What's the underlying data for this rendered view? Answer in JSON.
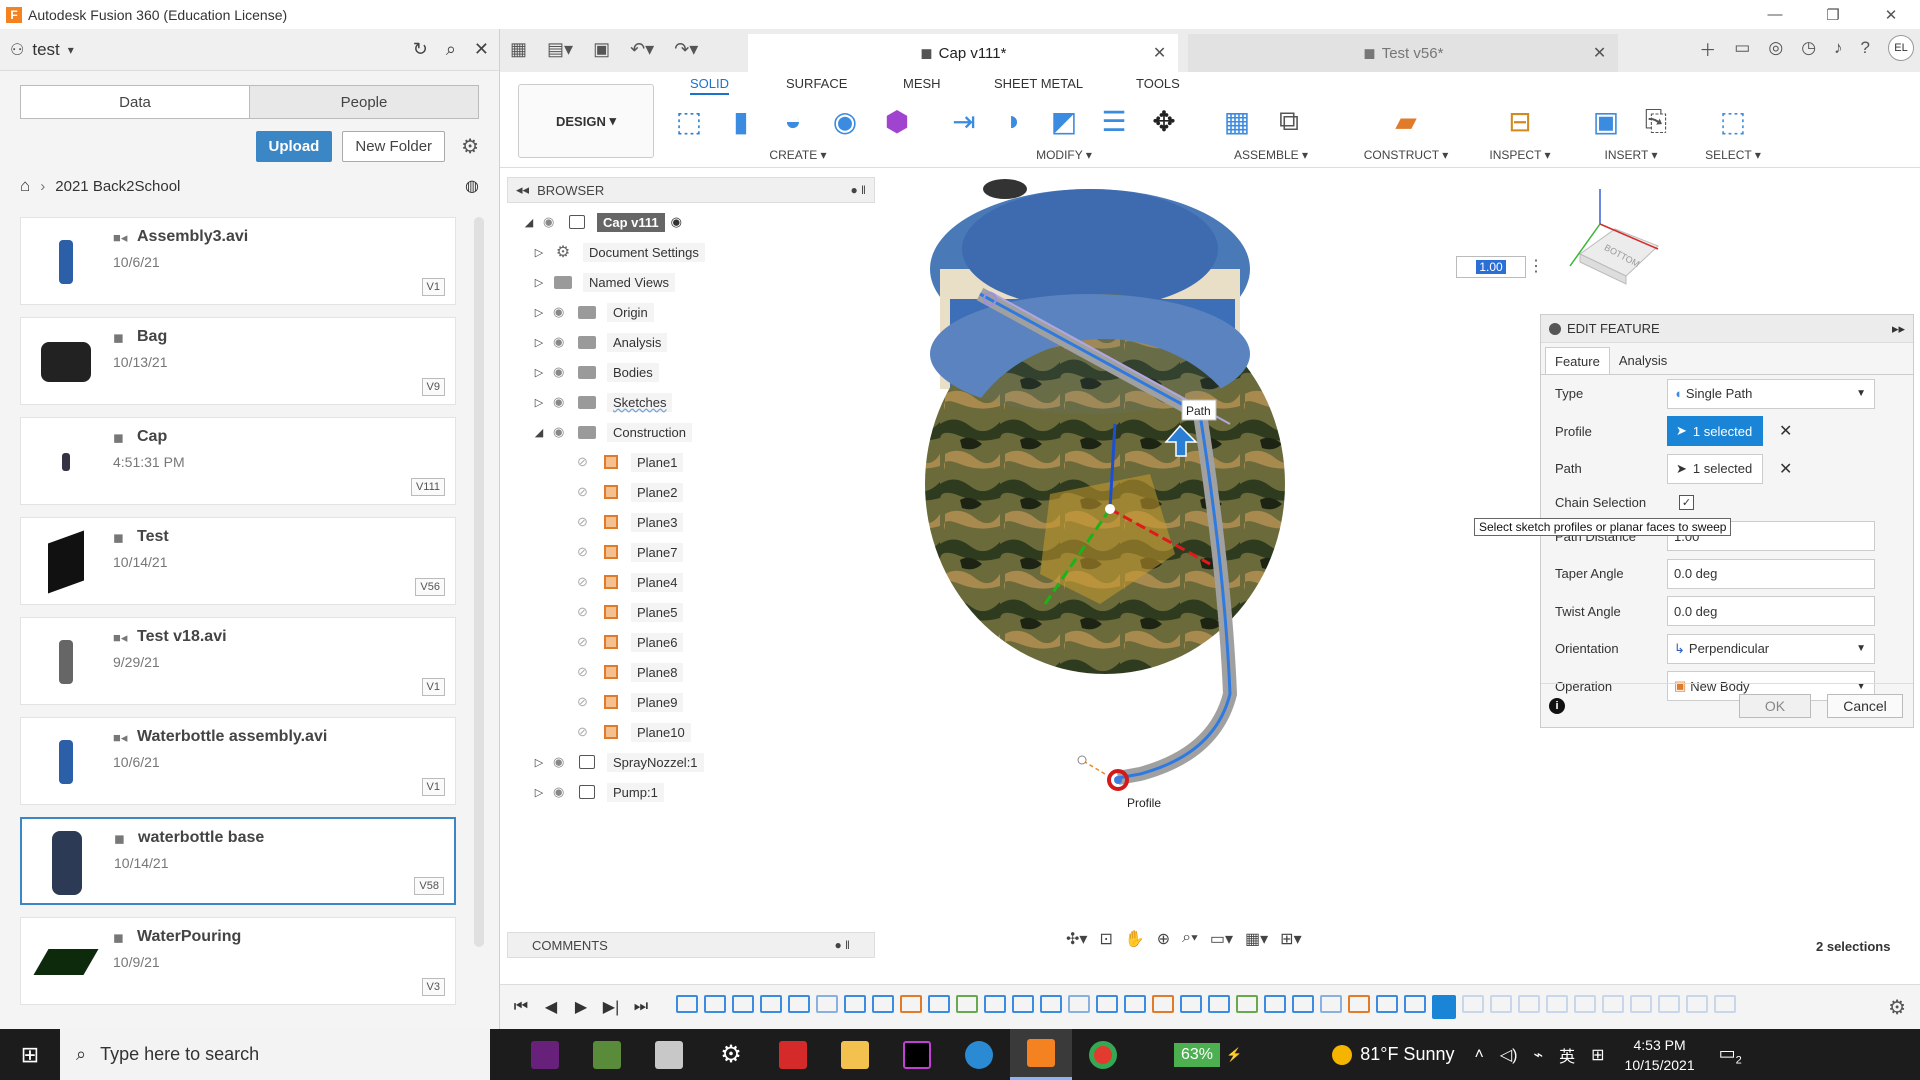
{
  "window": {
    "title": "Autodesk Fusion 360 (Education License)",
    "app_icon": "F"
  },
  "data_panel": {
    "project": "test",
    "tabs": [
      "Data",
      "People"
    ],
    "upload_label": "Upload",
    "new_folder_label": "New Folder",
    "breadcrumb": "2021 Back2School",
    "files": [
      {
        "name": "Assembly3.avi",
        "date": "10/6/21",
        "version": "V1",
        "type": "video"
      },
      {
        "name": "Bag",
        "date": "10/13/21",
        "version": "V9",
        "type": "design"
      },
      {
        "name": "Cap",
        "date": "4:51:31 PM",
        "version": "V111",
        "type": "design"
      },
      {
        "name": "Test",
        "date": "10/14/21",
        "version": "V56",
        "type": "design"
      },
      {
        "name": "Test v18.avi",
        "date": "9/29/21",
        "version": "V1",
        "type": "video"
      },
      {
        "name": "Waterbottle assembly.avi",
        "date": "10/6/21",
        "version": "V1",
        "type": "video"
      },
      {
        "name": "waterbottle base",
        "date": "10/14/21",
        "version": "V58",
        "type": "design"
      },
      {
        "name": "WaterPouring",
        "date": "10/9/21",
        "version": "V3",
        "type": "design"
      }
    ]
  },
  "doc_tabs": {
    "active": "Cap v111*",
    "inactive": "Test v56*"
  },
  "user_initials": "EL",
  "toolbar": {
    "workspace": "DESIGN",
    "mode_tabs": [
      "SOLID",
      "SURFACE",
      "MESH",
      "SHEET METAL",
      "TOOLS"
    ],
    "groups": [
      "CREATE",
      "MODIFY",
      "ASSEMBLE",
      "CONSTRUCT",
      "INSPECT",
      "INSERT",
      "SELECT"
    ]
  },
  "browser": {
    "title": "BROWSER",
    "root": "Cap v111",
    "items": [
      "Document Settings",
      "Named Views",
      "Origin",
      "Analysis",
      "Bodies",
      "Sketches",
      "Construction"
    ],
    "planes": [
      "Plane1",
      "Plane2",
      "Plane3",
      "Plane7",
      "Plane4",
      "Plane5",
      "Plane6",
      "Plane8",
      "Plane9",
      "Plane10"
    ],
    "components": [
      "SprayNozzel:1",
      "Pump:1"
    ]
  },
  "comments_label": "COMMENTS",
  "viewport": {
    "distance_value": "1.00",
    "path_label": "Path",
    "profile_label": "Profile",
    "tooltip": "Select sketch profiles or planar faces to sweep",
    "selections": "2 selections",
    "viewcube_label": "BOTTOM"
  },
  "edit_feature": {
    "title": "EDIT FEATURE",
    "tabs": [
      "Feature",
      "Analysis"
    ],
    "type_label": "Type",
    "type_value": "Single Path",
    "profile_label": "Profile",
    "profile_value": "1 selected",
    "path_label": "Path",
    "path_value": "1 selected",
    "chain_label": "Chain Selection",
    "distance_label": "Path Distance",
    "distance_value": "1.00",
    "taper_label": "Taper Angle",
    "taper_value": "0.0 deg",
    "twist_label": "Twist Angle",
    "twist_value": "0.0 deg",
    "orientation_label": "Orientation",
    "orientation_value": "Perpendicular",
    "operation_label": "Operation",
    "operation_value": "New Body",
    "ok_label": "OK",
    "cancel_label": "Cancel"
  },
  "taskbar": {
    "search_placeholder": "Type here to search",
    "battery": "63%",
    "weather": "81°F  Sunny",
    "ime": "英",
    "time": "4:53 PM",
    "date": "10/15/2021",
    "notifications": "2"
  }
}
